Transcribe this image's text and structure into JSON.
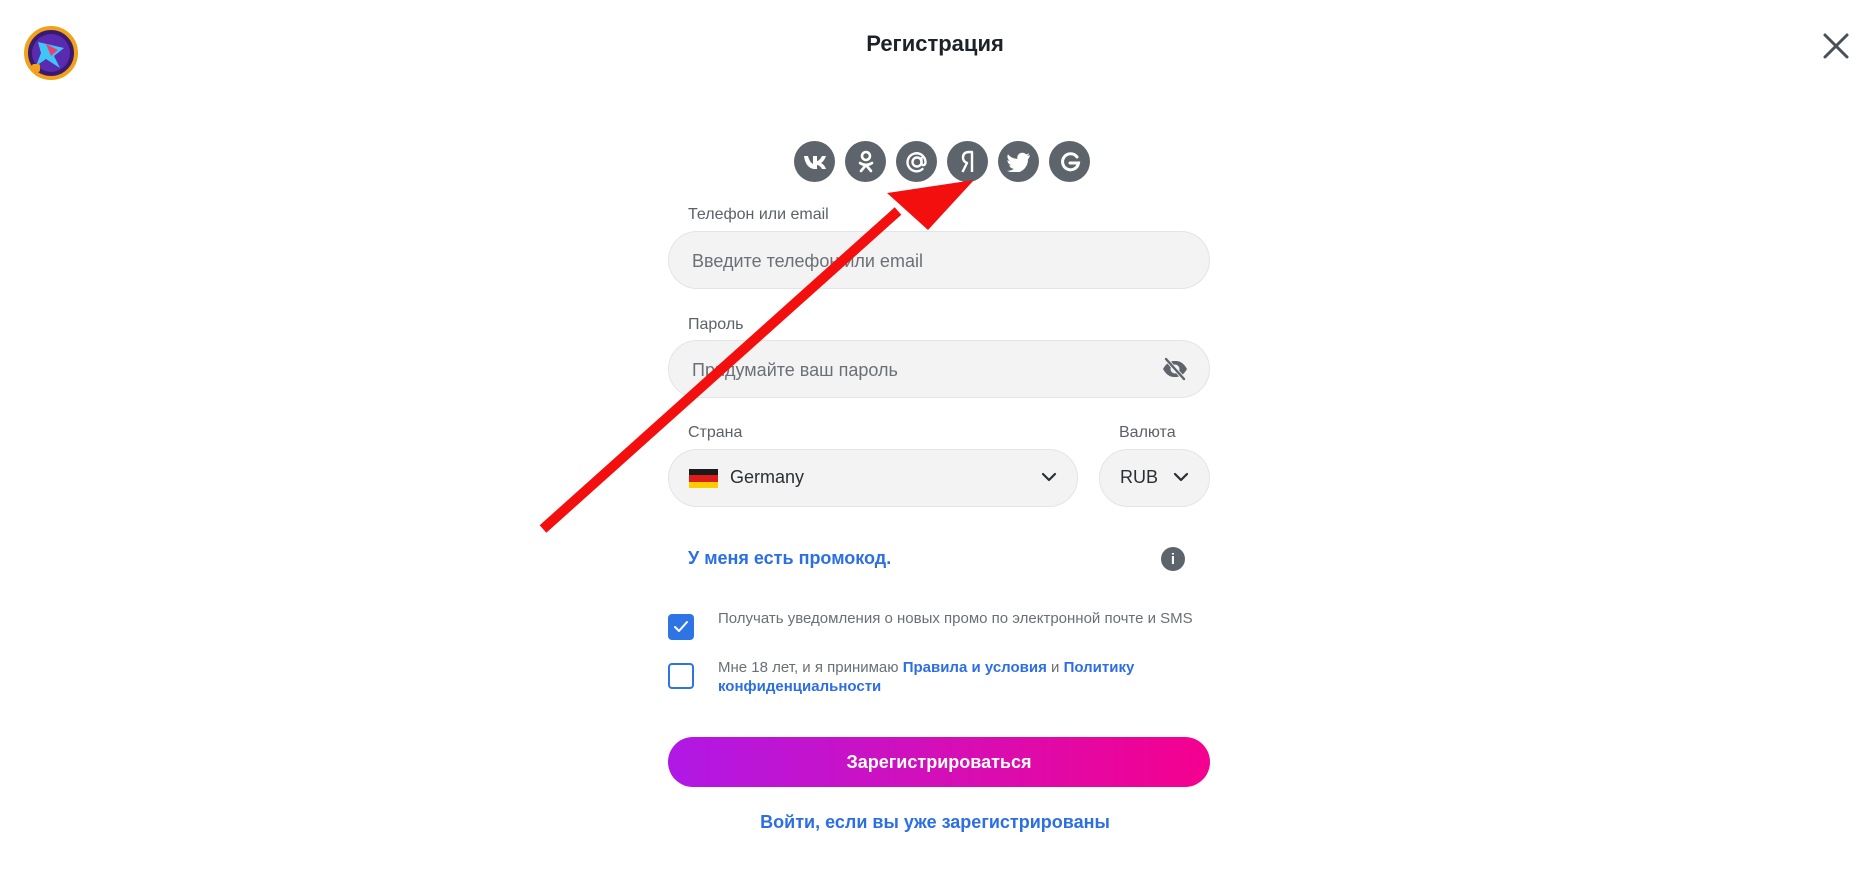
{
  "header": {
    "title": "Регистрация"
  },
  "social": {
    "icons": [
      "vk-icon",
      "odnoklassniki-icon",
      "mail-ru-icon",
      "yandex-icon",
      "twitter-icon",
      "google-icon"
    ]
  },
  "form": {
    "phone_label": "Телефон или email",
    "phone_placeholder": "Введите телефон или email",
    "password_label": "Пароль",
    "password_placeholder": "Придумайте ваш пароль",
    "country_label": "Страна",
    "country_value": "Germany",
    "currency_label": "Валюта",
    "currency_value": "RUB",
    "promo_link": "У меня есть промокод.",
    "notify_checkbox": {
      "checked": true,
      "text": "Получать уведомления о новых промо по электронной почте и SMS"
    },
    "terms_checkbox": {
      "checked": false,
      "text_prefix": "Мне 18 лет, и я принимаю ",
      "terms_link": "Правила и условия",
      "and": " и ",
      "privacy_link": "Политику конфиденциальности"
    },
    "submit_label": "Зарегистрироваться",
    "login_link": "Войти, если вы уже зарегистрированы"
  },
  "colors": {
    "accent_blue": "#2c6fe4",
    "button_gradient_start": "#b018e6",
    "button_gradient_end": "#f5008e",
    "social_icon_bg": "#5d646b",
    "annotation_arrow": "#f40f0f"
  }
}
